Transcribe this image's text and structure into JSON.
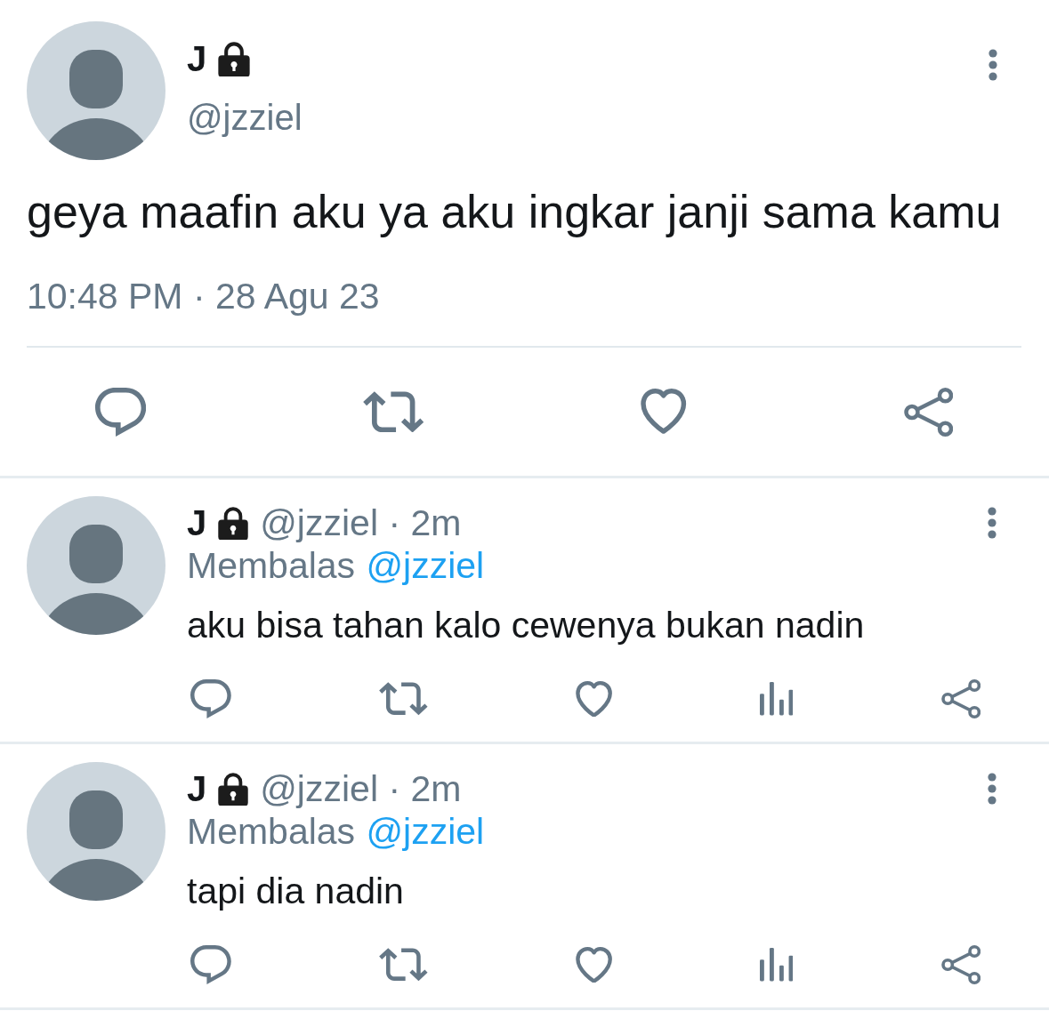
{
  "tweet": {
    "author": {
      "name": "J",
      "protected": true,
      "handle": "@jzziel"
    },
    "text": "geya maafin aku ya aku ingkar janji sama kamu",
    "timestamp": "10:48 PM · 28 Agu 23",
    "actions": [
      {
        "kind": "reply"
      },
      {
        "kind": "retweet"
      },
      {
        "kind": "like"
      },
      {
        "kind": "share"
      }
    ]
  },
  "replies": [
    {
      "author": {
        "name": "J",
        "protected": true
      },
      "byline": "@jzziel · 2m",
      "replying_to": {
        "label": "Membalas",
        "handle": "@jzziel"
      },
      "text": "aku bisa tahan kalo cewenya bukan nadin",
      "actions": [
        {
          "kind": "reply"
        },
        {
          "kind": "retweet"
        },
        {
          "kind": "like"
        },
        {
          "kind": "views"
        },
        {
          "kind": "share"
        }
      ]
    },
    {
      "author": {
        "name": "J",
        "protected": true
      },
      "byline": "@jzziel · 2m",
      "replying_to": {
        "label": "Membalas",
        "handle": "@jzziel"
      },
      "text": "tapi dia nadin",
      "actions": [
        {
          "kind": "reply"
        },
        {
          "kind": "retweet"
        },
        {
          "kind": "like"
        },
        {
          "kind": "views"
        },
        {
          "kind": "share"
        }
      ]
    }
  ]
}
